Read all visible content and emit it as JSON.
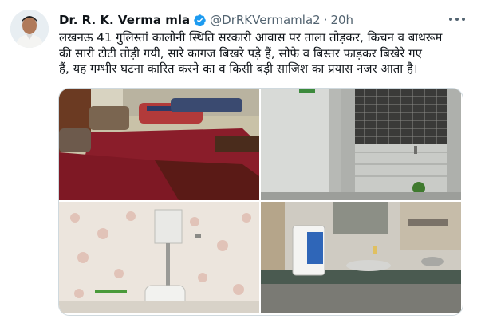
{
  "tweet": {
    "author_name": "Dr. R. K. Verma mla",
    "handle": "@DrRKVermamla2",
    "separator": "·",
    "time": "20h",
    "text_line1": "लखनऊ 41 गुलिस्तां कालोनी स्थिति सरकारी आवास पर ताला तोड़कर, किचन व बाथरूम",
    "text_line2": "की सारी टोटी तोड़ी गयी, सारे कागज बिखरे पड़े हैं, सोफे व बिस्तर फाड़कर बिखेरे गए",
    "text_line3": "हैं, यह गम्भीर घटना कारित करने का व किसी बड़ी साजिश का प्रयास नजर आता है।"
  },
  "icons": {
    "verified": "verified-badge-icon",
    "more": "more-options-icon"
  },
  "colors": {
    "verified_blue": "#1d9bf0",
    "muted_text": "#536471",
    "border": "#cfd9de"
  },
  "photos": [
    {
      "subject": "bedroom-with-mattresses"
    },
    {
      "subject": "room-with-window-grill"
    },
    {
      "subject": "bathroom-with-broken-taps"
    },
    {
      "subject": "kitchen-counter-with-water-purifier"
    }
  ]
}
